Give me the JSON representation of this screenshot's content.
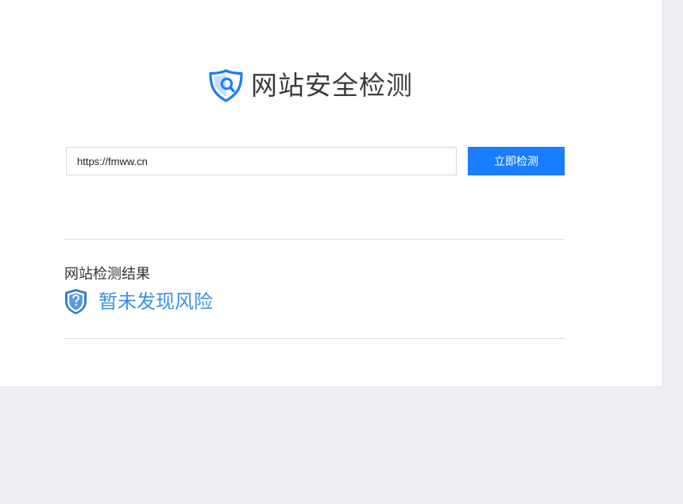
{
  "brand": {
    "title": "网站安全检测",
    "logo_icon": "shield-search-icon",
    "accent_color": "#1a7cff"
  },
  "search": {
    "value": "https://fmww.cn",
    "button_label": "立即检测",
    "button_color": "#1a7cff"
  },
  "result": {
    "heading": "网站检测结果",
    "status_text": "暂未发现风险",
    "status_icon": "shield-question-icon",
    "status_color": "#3e8fe6"
  }
}
